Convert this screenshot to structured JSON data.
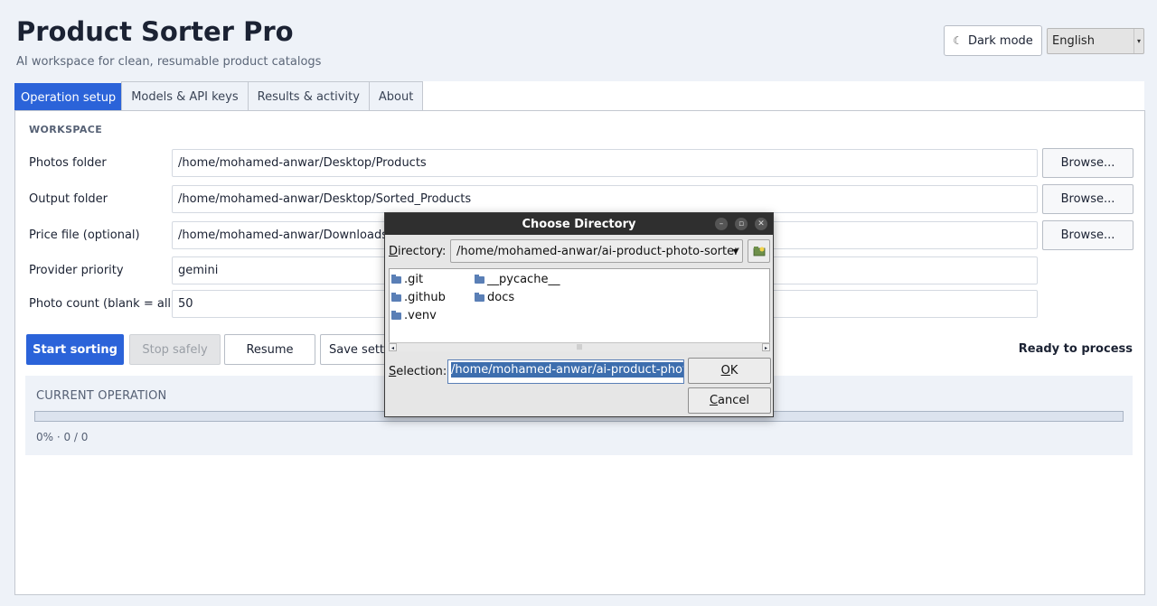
{
  "header": {
    "title": "Product Sorter Pro",
    "subtitle": "AI workspace for clean, resumable product catalogs",
    "dark_mode_label": "Dark mode",
    "language": "English"
  },
  "tabs": [
    {
      "label": "Operation setup",
      "active": true
    },
    {
      "label": "Models & API keys"
    },
    {
      "label": "Results & activity"
    },
    {
      "label": "About"
    }
  ],
  "workspace": {
    "section_label": "WORKSPACE",
    "photos_label": "Photos folder",
    "photos_value": "/home/mohamed-anwar/Desktop/Products",
    "output_label": "Output folder",
    "output_value": "/home/mohamed-anwar/Desktop/Sorted_Products",
    "price_label": "Price file (optional)",
    "price_value": "/home/mohamed-anwar/Downloads",
    "provider_label": "Provider priority",
    "provider_value": "gemini",
    "count_label": "Photo count (blank = all)",
    "count_value": "50",
    "browse_label": "Browse..."
  },
  "actions": {
    "start": "Start sorting",
    "stop": "Stop safely",
    "resume": "Resume",
    "save": "Save settings",
    "status": "Ready to process"
  },
  "operation": {
    "label": "CURRENT OPERATION",
    "progress_fraction": 0,
    "progress_text": "0% · 0 / 0"
  },
  "dialog": {
    "title": "Choose Directory",
    "directory_label": "Directory:",
    "directory_value": "/home/mohamed-anwar/ai-product-photo-sorter",
    "folders_col1": [
      ".git",
      ".github",
      ".venv"
    ],
    "folders_col2": [
      "__pycache__",
      "docs"
    ],
    "selection_label": "Selection:",
    "selection_value": "/home/mohamed-anwar/ai-product-photo-sorter",
    "ok_label": "OK",
    "cancel_label": "Cancel"
  },
  "colors": {
    "accent": "#2b63d9",
    "background": "#eef2f8",
    "dialog_titlebar": "#2f2f2f"
  },
  "icons": [
    "moon-icon",
    "chevron-down-icon",
    "folder-icon",
    "new-folder-icon",
    "minimize-icon",
    "maximize-icon",
    "close-icon"
  ]
}
